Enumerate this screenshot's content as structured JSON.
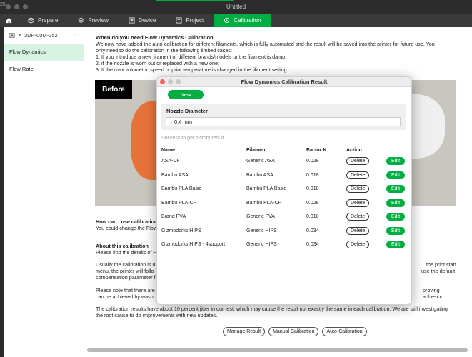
{
  "window": {
    "title": "Untitled",
    "left_fragment": "25"
  },
  "tabs": [
    {
      "label": "Prepare",
      "icon": "cube-icon"
    },
    {
      "label": "Preview",
      "icon": "layers-icon"
    },
    {
      "label": "Device",
      "icon": "device-icon"
    },
    {
      "label": "Project",
      "icon": "project-icon"
    },
    {
      "label": "Calibration",
      "icon": "calibration-icon",
      "active": true
    }
  ],
  "sidebar": {
    "printer": "3DP-00M-252",
    "items": [
      {
        "label": "Flow Dynamics",
        "active": true
      },
      {
        "label": "Flow Rate",
        "active": false
      }
    ]
  },
  "main": {
    "intro_heading": "When do you need Flow Dynamics Calibration",
    "intro_lines": [
      "We now have added the auto-calibration for different filaments, which is fully automated and the result will be saved into the printer for future use. You",
      "only need to do the calibration in the following limited cases:",
      "1. If you introduce a new filament of different brands/models or the filament is damp;",
      "2. if the nozzle is worn out or replaced with a new one;",
      "3. If the max volumetric speed or print temperature is changed in the filament setting."
    ],
    "hero_label": "Before",
    "how_heading": "How can I use calibration",
    "how_line": "You could change the Flow",
    "about_heading": "About this calibration",
    "about_line": "Please find the details of F",
    "usual_line1": "Usually the calibration is u",
    "usual_right1": "the print start",
    "usual_line2": "menu, the printer will follo",
    "usual_right2": "use the default",
    "usual_line3": "compensation parameter f",
    "note_line1": "Please note that there are",
    "note_right1": "proving adhesion",
    "note_line2": "can be achieved by washi",
    "results_line1": "The calibration results have about 10 percent jitter in our test, which may cause the result not exactly the same in each calibration. We are still investigating",
    "results_line2": "the root cause to do improvements with new updates.",
    "buttons": {
      "manage": "Manage Result",
      "manual": "Manual Calibration",
      "auto": "Auto-Calibration"
    }
  },
  "dialog": {
    "title": "Flow Dynamics Calibration Result",
    "new_label": "New",
    "nozzle_label": "Nozzle Diameter",
    "nozzle_value": "0.4 mm",
    "history_msg": "Success to get history result",
    "columns": {
      "name": "Name",
      "filament": "Filament",
      "factor": "Factor K",
      "action": "Action"
    },
    "delete_label": "Delete",
    "edit_label": "Edit",
    "rows": [
      {
        "name": "ASA-CF",
        "filament": "Generic ASA",
        "k": "0.028"
      },
      {
        "name": "Bambu ASA",
        "filament": "Bambu ASA",
        "k": "0.018"
      },
      {
        "name": "Bambu PLA Basic",
        "filament": "Bambu PLA Basic",
        "k": "0.018"
      },
      {
        "name": "Bambu PLA-CF",
        "filament": "Bambu PLA-CF",
        "k": "0.028"
      },
      {
        "name": "Brand PVA",
        "filament": "Generic PVA",
        "k": "0.018"
      },
      {
        "name": "Gizmodorks HIPS",
        "filament": "Generic HIPS",
        "k": "0.034"
      },
      {
        "name": "Gizmodorks HIPS - 4support",
        "filament": "Generic HIPS",
        "k": "0.034"
      }
    ]
  },
  "colors": {
    "accent": "#00ae42",
    "close": "#ff5f57",
    "min": "#c8c8c8",
    "max": "#c8c8c8"
  }
}
